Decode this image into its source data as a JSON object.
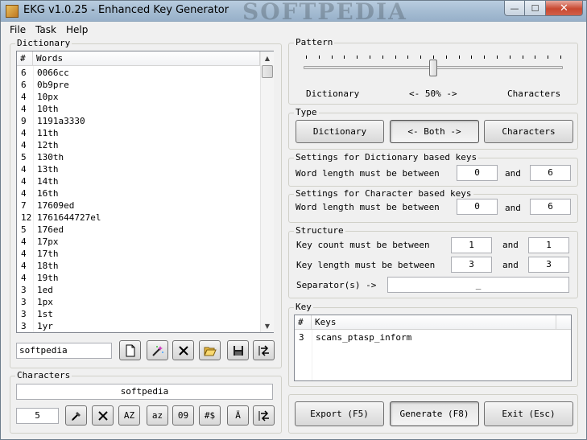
{
  "window": {
    "title": "EKG v1.0.25 - Enhanced Key Generator",
    "watermark": "SOFTPEDIA",
    "minimize_glyph": "—",
    "maximize_glyph": "☐",
    "close_glyph": "✕"
  },
  "menu": [
    "File",
    "Task",
    "Help"
  ],
  "dictionary": {
    "label": "Dictionary",
    "columns": [
      "#",
      "Words"
    ],
    "rows": [
      [
        "6",
        "0066cc"
      ],
      [
        "6",
        "0b9pre"
      ],
      [
        "4",
        "10px"
      ],
      [
        "4",
        "10th"
      ],
      [
        "9",
        "1191a3330"
      ],
      [
        "4",
        "11th"
      ],
      [
        "4",
        "12th"
      ],
      [
        "5",
        "130th"
      ],
      [
        "4",
        "13th"
      ],
      [
        "4",
        "14th"
      ],
      [
        "4",
        "16th"
      ],
      [
        "7",
        "17609ed"
      ],
      [
        "12",
        "1761644727el"
      ],
      [
        "5",
        "176ed"
      ],
      [
        "4",
        "17px"
      ],
      [
        "4",
        "17th"
      ],
      [
        "4",
        "18th"
      ],
      [
        "4",
        "19th"
      ],
      [
        "3",
        "1ed"
      ],
      [
        "3",
        "1px"
      ],
      [
        "3",
        "1st"
      ],
      [
        "3",
        "1yr"
      ]
    ],
    "input_value": "softpedia",
    "toolbar_icons": [
      "new-file-icon",
      "magic-wand-icon",
      "delete-icon",
      "open-folder-icon",
      "save-icon",
      "transfer-icon"
    ]
  },
  "characters": {
    "label": "Characters",
    "value": "softpedia",
    "count_value": "5",
    "buttons": {
      "az_upper": "AZ",
      "az_lower": "az",
      "digits": "09",
      "symbols": "#$",
      "accents": "Ä"
    }
  },
  "pattern": {
    "label": "Pattern",
    "left": "Dictionary",
    "center": "<- 50% ->",
    "right": "Characters",
    "slider_fraction": 0.5
  },
  "type": {
    "label": "Type",
    "dictionary_button": "Dictionary",
    "both_button": "<- Both ->",
    "characters_button": "Characters"
  },
  "dict_settings": {
    "label": "Settings for Dictionary based keys",
    "text": "Word length must be between",
    "min": "0",
    "and": "and",
    "max": "6"
  },
  "char_settings": {
    "label": "Settings for Character based keys",
    "text": "Word length must be between",
    "min": "0",
    "and": "and",
    "max": "6"
  },
  "structure": {
    "label": "Structure",
    "key_count_text": "Key count must be between",
    "key_count_min": "1",
    "key_count_max": "1",
    "key_length_text": "Key length must be between",
    "key_length_min": "3",
    "key_length_max": "3",
    "and": "and",
    "separator_text": "Separator(s) ->",
    "separator_value": "_"
  },
  "key": {
    "label": "Key",
    "columns": [
      "#",
      "Keys"
    ],
    "rows": [
      [
        "3",
        "scans_ptasp_inform"
      ]
    ]
  },
  "actions": {
    "export": "Export (F5)",
    "generate": "Generate (F8)",
    "exit": "Exit (Esc)"
  }
}
